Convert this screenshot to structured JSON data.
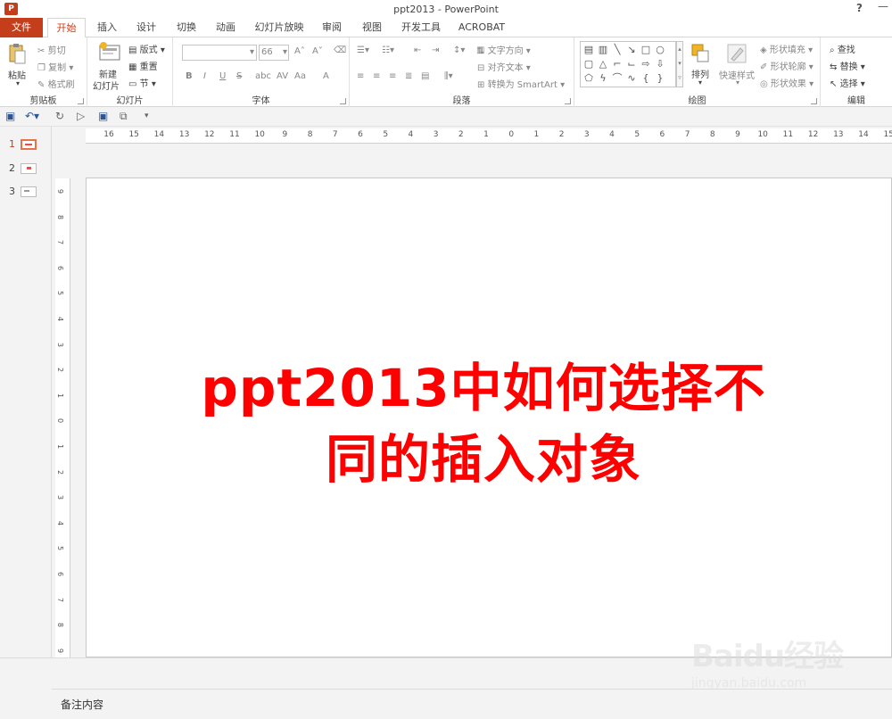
{
  "window": {
    "title": "ppt2013 - PowerPoint",
    "help": "?",
    "minimize": "—",
    "app_icon_letter": "P"
  },
  "tabs": [
    {
      "label": "文件"
    },
    {
      "label": "开始"
    },
    {
      "label": "插入"
    },
    {
      "label": "设计"
    },
    {
      "label": "切换"
    },
    {
      "label": "动画"
    },
    {
      "label": "幻灯片放映"
    },
    {
      "label": "审阅"
    },
    {
      "label": "视图"
    },
    {
      "label": "开发工具"
    },
    {
      "label": "ACROBAT"
    }
  ],
  "ribbon": {
    "clipboard": {
      "label": "剪贴板",
      "paste": "粘贴",
      "cut": "剪切",
      "copy": "复制",
      "format_painter": "格式刷"
    },
    "slides": {
      "label": "幻灯片",
      "new_slide_line1": "新建",
      "new_slide_line2": "幻灯片",
      "layout": "版式",
      "reset": "重置",
      "section": "节"
    },
    "font": {
      "label": "字体",
      "font_name": "",
      "font_size": "66",
      "bold": "B",
      "italic": "I",
      "underline": "U",
      "strike": "S",
      "shadow": "abc",
      "spacing": "AV",
      "case": "Aa",
      "color": "A"
    },
    "paragraph": {
      "label": "段落",
      "text_direction": "文字方向",
      "align_text": "对齐文本",
      "smartart": "转换为 SmartArt"
    },
    "drawing": {
      "label": "绘图",
      "arrange": "排列",
      "quick_styles": "快速样式",
      "shape_fill": "形状填充",
      "shape_outline": "形状轮廓",
      "shape_effects": "形状效果"
    },
    "editing": {
      "label": "编辑",
      "find": "查找",
      "replace": "替换",
      "select": "选择"
    }
  },
  "ruler": {
    "horizontal": [
      "16",
      "15",
      "14",
      "13",
      "12",
      "11",
      "10",
      "9",
      "8",
      "7",
      "6",
      "5",
      "4",
      "3",
      "2",
      "1",
      "0",
      "1",
      "2",
      "3",
      "4",
      "5",
      "6",
      "7",
      "8",
      "9",
      "10",
      "11",
      "12",
      "13",
      "14",
      "15"
    ],
    "vertical": [
      "9",
      "8",
      "7",
      "6",
      "5",
      "4",
      "3",
      "2",
      "1",
      "0",
      "1",
      "2",
      "3",
      "4",
      "5",
      "6",
      "7",
      "8",
      "9"
    ]
  },
  "thumbnails": [
    {
      "num": "1"
    },
    {
      "num": "2"
    },
    {
      "num": "3"
    }
  ],
  "slide": {
    "title_line1": "ppt2013中如何选择不",
    "title_line2": "同的插入对象",
    "title_color": "#ff0000"
  },
  "notes": {
    "placeholder": "备注内容"
  },
  "watermark": {
    "brand": "Baidu经验",
    "url": "jingyan.baidu.com"
  },
  "colors": {
    "accent": "#c43e1c",
    "selected_thumb_border": "#e8734a"
  }
}
